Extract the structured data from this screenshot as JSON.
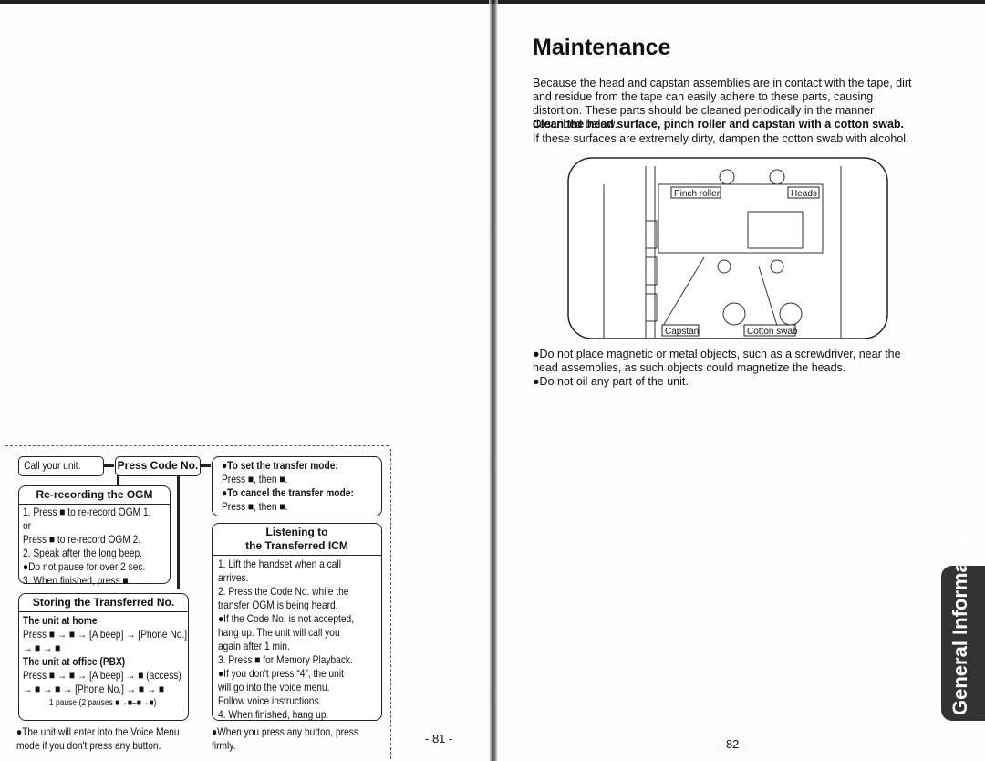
{
  "left": {
    "call_unit": "Call your unit.",
    "press_code": "Press Code No.",
    "rerecord": {
      "title": "Re-recording the OGM",
      "lines": [
        "1.  Press ■ to re-record OGM 1.",
        "     or",
        "     Press ■ to re-record OGM 2.",
        "2.  Speak after the long beep.",
        "     ●Do not pause for over 2 sec.",
        "3.  When finished, press ■."
      ]
    },
    "storing": {
      "title": "Storing the Transferred No.",
      "home_title": "The unit at home",
      "home_lines": [
        "Press ■ → ■ → [A beep] → [Phone No.]",
        "     → ■ → ■"
      ],
      "office_title": "The unit at office (PBX)",
      "office_lines": [
        "Press ■ → ■ → [A beep] → ■ (access)",
        "     → ■ → ■ → [Phone No.] → ■ → ■"
      ],
      "pause_note": "1 pause (2 pauses ■→■–■→■)"
    },
    "note": [
      "●The unit will enter into the Voice Menu",
      "  mode if you don't press any button."
    ],
    "transfer": [
      "●To set the transfer mode:",
      "  Press ■, then ■.",
      "●To cancel the transfer mode:",
      "  Press ■, then ■."
    ],
    "listening": {
      "title1": "Listening to",
      "title2": "the Transferred ICM",
      "lines": [
        "1.  Lift the handset when a call",
        "     arrives.",
        "2.  Press the Code No. while the",
        "     transfer OGM is being heard.",
        "     ●If the Code No. is not accepted,",
        "       hang up. The unit will call you",
        "       again after 1 min.",
        "3.  Press ■ for Memory Playback.",
        "     ●If you don't press “4”, the unit",
        "       will go into the voice menu.",
        "       Follow voice instructions.",
        "4.  When finished, hang up."
      ]
    },
    "note2": [
      "●When you press any button, press",
      "  firmly."
    ],
    "page_number": "- 81 -"
  },
  "right": {
    "title": "Maintenance",
    "intro": "Because the head and capstan assemblies are in contact with the tape, dirt and residue from the tape can easily adhere to these parts, causing distortion. These parts should be cleaned periodically in the manner described below.",
    "bold": "Clean the head surface, pinch roller and capstan with a cotton swab.",
    "dirty": "If these surfaces are extremely dirty, dampen the cotton swab with alcohol.",
    "diagram_labels": {
      "pinch": "Pinch roller",
      "heads": "Heads",
      "capstan": "Capstan",
      "swab": "Cotton swab"
    },
    "bullets": [
      "●Do not place magnetic or metal objects, such as a screwdriver, near the head assemblies, as such objects could magnetize the heads.",
      "●Do not oil any part of the unit."
    ],
    "tab": "General Information",
    "page_number": "- 82 -"
  }
}
